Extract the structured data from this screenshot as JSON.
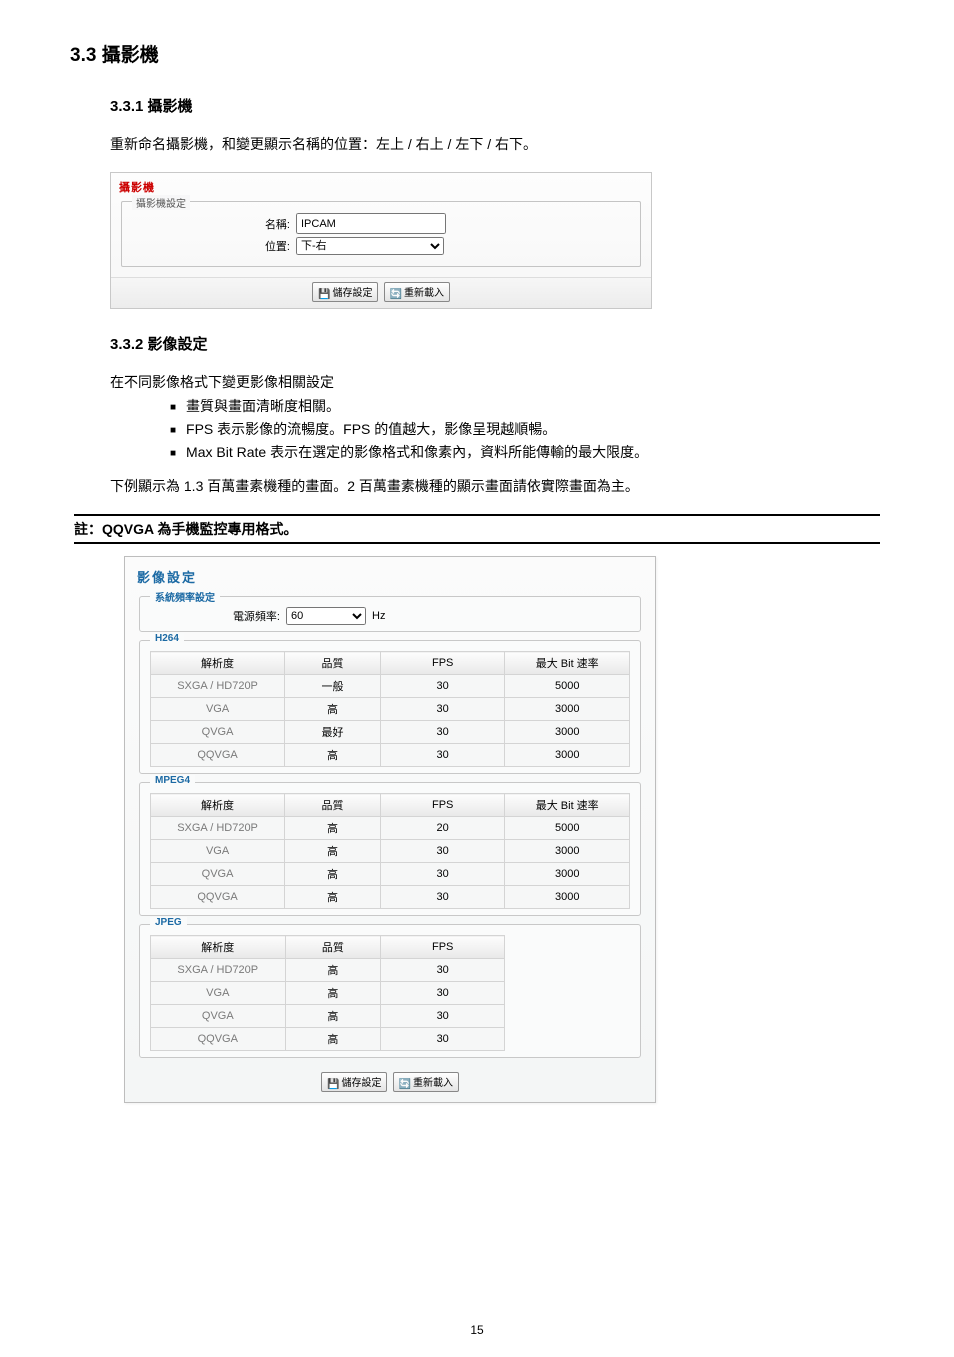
{
  "heading": "3.3 攝影機",
  "sec331": {
    "title": "3.3.1 攝影機",
    "para": "重新命名攝影機，和變更顯示名稱的位置：左上 / 右上 / 左下 / 右下。"
  },
  "panel1": {
    "title": "攝影機",
    "fieldset_legend": "攝影機設定",
    "label_name": "名稱:",
    "value_name": "IPCAM",
    "label_pos": "位置:",
    "value_pos": "下-右",
    "btn_save": "儲存設定",
    "btn_reload": "重新載入"
  },
  "sec332": {
    "title": "3.3.2 影像設定",
    "para": "在不同影像格式下變更影像相關設定",
    "bullets": [
      "畫質與畫面清晰度相關。",
      "FPS 表示影像的流暢度。FPS 的值越大，影像呈現越順暢。",
      "Max Bit Rate 表示在選定的影像格式和像素內，資料所能傳輸的最大限度。"
    ],
    "note_prefix": "註：",
    "example": "下例顯示為 1.3 百萬畫素機種的畫面。2 百萬畫素機種的顯示畫面請依實際畫面為主。",
    "note": "QQVGA 為手機監控專用格式。"
  },
  "panel2": {
    "title": "影像設定",
    "freq_legend": "系統頻率設定",
    "freq_label": "電源頻率:",
    "freq_value": "60",
    "freq_unit": "Hz",
    "headers4": {
      "c1": "解析度",
      "c2": "品質",
      "c3": "FPS",
      "c4": "最大 Bit 速率"
    },
    "headers3": {
      "c1": "解析度",
      "c2": "品質",
      "c3": "FPS"
    },
    "h264_label": "H264",
    "h264": [
      {
        "res": "SXGA / HD720P",
        "q": "一般",
        "fps": "30",
        "bit": "5000"
      },
      {
        "res": "VGA",
        "q": "高",
        "fps": "30",
        "bit": "3000"
      },
      {
        "res": "QVGA",
        "q": "最好",
        "fps": "30",
        "bit": "3000"
      },
      {
        "res": "QQVGA",
        "q": "高",
        "fps": "30",
        "bit": "3000"
      }
    ],
    "mpeg4_label": "MPEG4",
    "mpeg4": [
      {
        "res": "SXGA / HD720P",
        "q": "高",
        "fps": "20",
        "bit": "5000"
      },
      {
        "res": "VGA",
        "q": "高",
        "fps": "30",
        "bit": "3000"
      },
      {
        "res": "QVGA",
        "q": "高",
        "fps": "30",
        "bit": "3000"
      },
      {
        "res": "QQVGA",
        "q": "高",
        "fps": "30",
        "bit": "3000"
      }
    ],
    "jpeg_label": "JPEG",
    "jpeg": [
      {
        "res": "SXGA / HD720P",
        "q": "高",
        "fps": "30"
      },
      {
        "res": "VGA",
        "q": "高",
        "fps": "30"
      },
      {
        "res": "QVGA",
        "q": "高",
        "fps": "30"
      },
      {
        "res": "QQVGA",
        "q": "高",
        "fps": "30"
      }
    ],
    "btn_save": "儲存設定",
    "btn_reload": "重新載入"
  },
  "page_number": "15"
}
